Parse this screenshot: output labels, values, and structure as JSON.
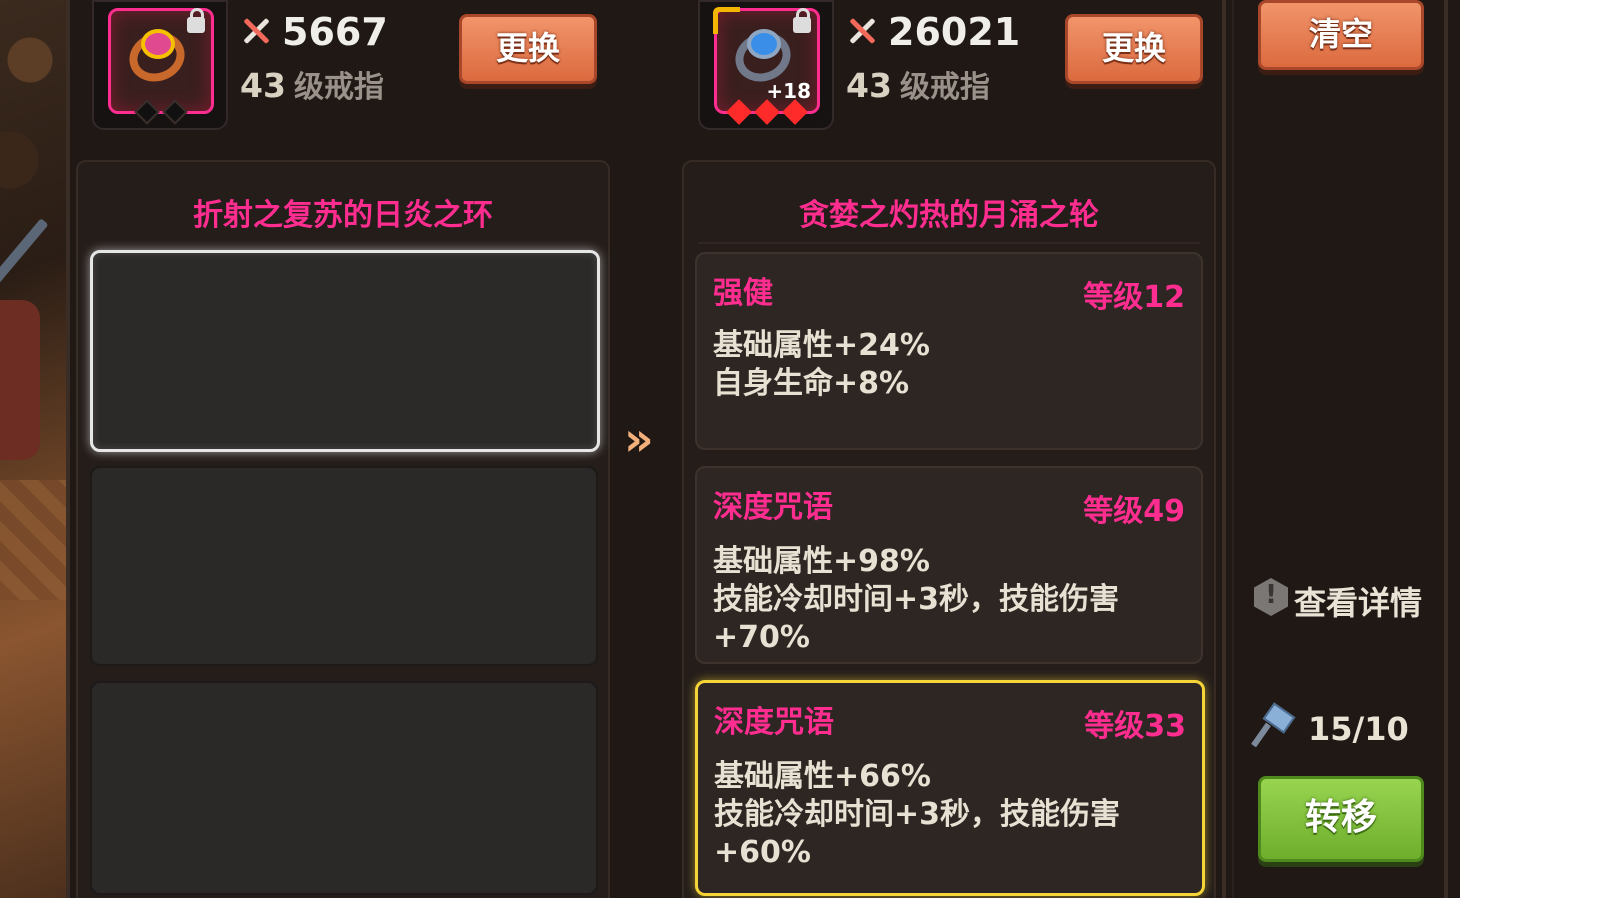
{
  "left_item": {
    "power": "5667",
    "level_num": "43",
    "level_text": "级戒指",
    "replace_label": "更换",
    "locked": true,
    "icon": "golden-ring-icon"
  },
  "right_item": {
    "power": "26021",
    "level_num": "43",
    "level_text": "级戒指",
    "replace_label": "更换",
    "enhance": "+18",
    "locked": true,
    "icon": "steel-ring-icon"
  },
  "clear_label": "清空",
  "left_panel": {
    "title": "折射之复苏的日炎之环"
  },
  "arrow": "»",
  "right_panel": {
    "title": "贪婪之灼热的月涌之轮",
    "affixes": [
      {
        "name": "强健",
        "level": "等级12",
        "lines": [
          "基础属性+24%",
          "自身生命+8%"
        ]
      },
      {
        "name": "深度咒语",
        "level": "等级49",
        "lines": [
          "基础属性+98%",
          "技能冷却时间+3秒，技能伤害",
          "+70%"
        ]
      },
      {
        "name": "深度咒语",
        "level": "等级33",
        "lines": [
          "基础属性+66%",
          "技能冷却时间+3秒，技能伤害",
          "+60%"
        ]
      }
    ]
  },
  "details_label": "查看详情",
  "hammer_count": "15/10",
  "transfer_label": "转移",
  "colors": {
    "accent_pink": "#ff2d8f",
    "button_orange": "#e57c4f",
    "button_green": "#82c23c",
    "highlight_gold": "#f5d437"
  }
}
